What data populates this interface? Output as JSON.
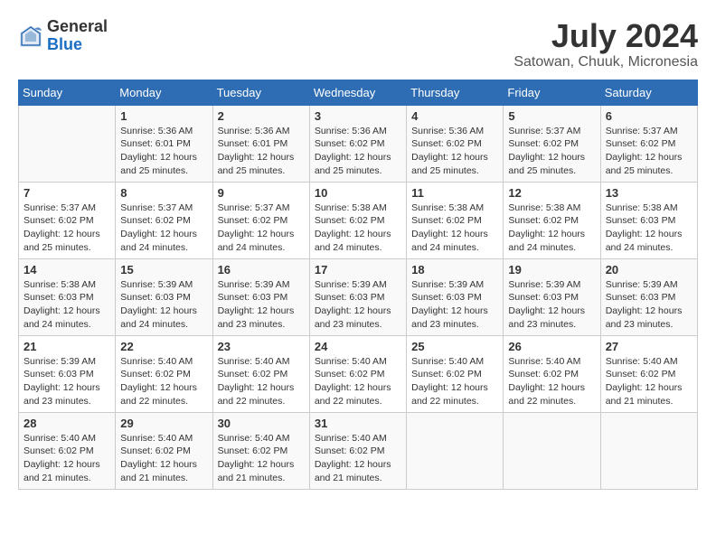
{
  "header": {
    "logo_general": "General",
    "logo_blue": "Blue",
    "title": "July 2024",
    "location": "Satowan, Chuuk, Micronesia"
  },
  "calendar": {
    "days_of_week": [
      "Sunday",
      "Monday",
      "Tuesday",
      "Wednesday",
      "Thursday",
      "Friday",
      "Saturday"
    ],
    "weeks": [
      [
        {
          "day": "",
          "info": ""
        },
        {
          "day": "1",
          "info": "Sunrise: 5:36 AM\nSunset: 6:01 PM\nDaylight: 12 hours\nand 25 minutes."
        },
        {
          "day": "2",
          "info": "Sunrise: 5:36 AM\nSunset: 6:01 PM\nDaylight: 12 hours\nand 25 minutes."
        },
        {
          "day": "3",
          "info": "Sunrise: 5:36 AM\nSunset: 6:02 PM\nDaylight: 12 hours\nand 25 minutes."
        },
        {
          "day": "4",
          "info": "Sunrise: 5:36 AM\nSunset: 6:02 PM\nDaylight: 12 hours\nand 25 minutes."
        },
        {
          "day": "5",
          "info": "Sunrise: 5:37 AM\nSunset: 6:02 PM\nDaylight: 12 hours\nand 25 minutes."
        },
        {
          "day": "6",
          "info": "Sunrise: 5:37 AM\nSunset: 6:02 PM\nDaylight: 12 hours\nand 25 minutes."
        }
      ],
      [
        {
          "day": "7",
          "info": "Sunrise: 5:37 AM\nSunset: 6:02 PM\nDaylight: 12 hours\nand 25 minutes."
        },
        {
          "day": "8",
          "info": "Sunrise: 5:37 AM\nSunset: 6:02 PM\nDaylight: 12 hours\nand 24 minutes."
        },
        {
          "day": "9",
          "info": "Sunrise: 5:37 AM\nSunset: 6:02 PM\nDaylight: 12 hours\nand 24 minutes."
        },
        {
          "day": "10",
          "info": "Sunrise: 5:38 AM\nSunset: 6:02 PM\nDaylight: 12 hours\nand 24 minutes."
        },
        {
          "day": "11",
          "info": "Sunrise: 5:38 AM\nSunset: 6:02 PM\nDaylight: 12 hours\nand 24 minutes."
        },
        {
          "day": "12",
          "info": "Sunrise: 5:38 AM\nSunset: 6:02 PM\nDaylight: 12 hours\nand 24 minutes."
        },
        {
          "day": "13",
          "info": "Sunrise: 5:38 AM\nSunset: 6:03 PM\nDaylight: 12 hours\nand 24 minutes."
        }
      ],
      [
        {
          "day": "14",
          "info": "Sunrise: 5:38 AM\nSunset: 6:03 PM\nDaylight: 12 hours\nand 24 minutes."
        },
        {
          "day": "15",
          "info": "Sunrise: 5:39 AM\nSunset: 6:03 PM\nDaylight: 12 hours\nand 24 minutes."
        },
        {
          "day": "16",
          "info": "Sunrise: 5:39 AM\nSunset: 6:03 PM\nDaylight: 12 hours\nand 23 minutes."
        },
        {
          "day": "17",
          "info": "Sunrise: 5:39 AM\nSunset: 6:03 PM\nDaylight: 12 hours\nand 23 minutes."
        },
        {
          "day": "18",
          "info": "Sunrise: 5:39 AM\nSunset: 6:03 PM\nDaylight: 12 hours\nand 23 minutes."
        },
        {
          "day": "19",
          "info": "Sunrise: 5:39 AM\nSunset: 6:03 PM\nDaylight: 12 hours\nand 23 minutes."
        },
        {
          "day": "20",
          "info": "Sunrise: 5:39 AM\nSunset: 6:03 PM\nDaylight: 12 hours\nand 23 minutes."
        }
      ],
      [
        {
          "day": "21",
          "info": "Sunrise: 5:39 AM\nSunset: 6:03 PM\nDaylight: 12 hours\nand 23 minutes."
        },
        {
          "day": "22",
          "info": "Sunrise: 5:40 AM\nSunset: 6:02 PM\nDaylight: 12 hours\nand 22 minutes."
        },
        {
          "day": "23",
          "info": "Sunrise: 5:40 AM\nSunset: 6:02 PM\nDaylight: 12 hours\nand 22 minutes."
        },
        {
          "day": "24",
          "info": "Sunrise: 5:40 AM\nSunset: 6:02 PM\nDaylight: 12 hours\nand 22 minutes."
        },
        {
          "day": "25",
          "info": "Sunrise: 5:40 AM\nSunset: 6:02 PM\nDaylight: 12 hours\nand 22 minutes."
        },
        {
          "day": "26",
          "info": "Sunrise: 5:40 AM\nSunset: 6:02 PM\nDaylight: 12 hours\nand 22 minutes."
        },
        {
          "day": "27",
          "info": "Sunrise: 5:40 AM\nSunset: 6:02 PM\nDaylight: 12 hours\nand 21 minutes."
        }
      ],
      [
        {
          "day": "28",
          "info": "Sunrise: 5:40 AM\nSunset: 6:02 PM\nDaylight: 12 hours\nand 21 minutes."
        },
        {
          "day": "29",
          "info": "Sunrise: 5:40 AM\nSunset: 6:02 PM\nDaylight: 12 hours\nand 21 minutes."
        },
        {
          "day": "30",
          "info": "Sunrise: 5:40 AM\nSunset: 6:02 PM\nDaylight: 12 hours\nand 21 minutes."
        },
        {
          "day": "31",
          "info": "Sunrise: 5:40 AM\nSunset: 6:02 PM\nDaylight: 12 hours\nand 21 minutes."
        },
        {
          "day": "",
          "info": ""
        },
        {
          "day": "",
          "info": ""
        },
        {
          "day": "",
          "info": ""
        }
      ]
    ]
  }
}
